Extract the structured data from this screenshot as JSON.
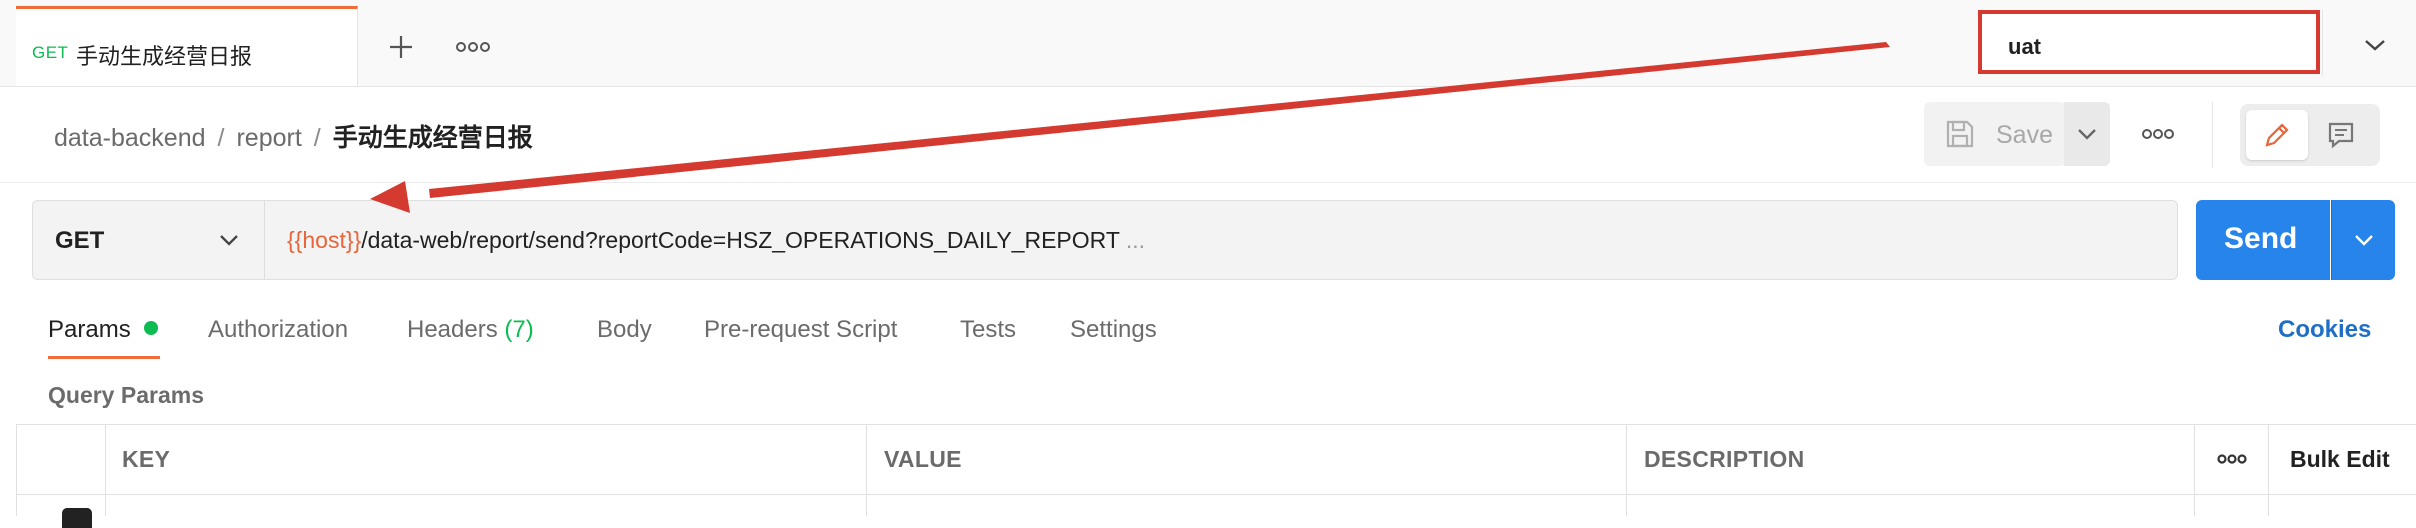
{
  "tab": {
    "method": "GET",
    "name": "手动生成经营日报"
  },
  "environment": {
    "selected": "uat"
  },
  "breadcrumb": {
    "items": [
      "data-backend",
      "report"
    ],
    "current": "手动生成经营日报"
  },
  "toolbar": {
    "save_label": "Save"
  },
  "request": {
    "method": "GET",
    "url_variable": "{{host}}",
    "url_path": "/data-web/report/send?reportCode=HSZ_OPERATIONS_DAILY_REPORT",
    "url_more": " ...",
    "send_label": "Send"
  },
  "subtabs": {
    "params": "Params",
    "authorization": "Authorization",
    "headers": "Headers",
    "headers_count": "(7)",
    "body": "Body",
    "prerequest": "Pre-request Script",
    "tests": "Tests",
    "settings": "Settings",
    "cookies": "Cookies"
  },
  "query_params": {
    "label": "Query Params",
    "columns": [
      "KEY",
      "VALUE",
      "DESCRIPTION"
    ],
    "bulk_edit": "Bulk Edit"
  },
  "colors": {
    "accent": "#f26b3a",
    "send": "#2684ea",
    "success": "#0cbb52",
    "annotation": "#d43a30"
  },
  "annotation": {
    "type": "arrow",
    "from": "environment-select",
    "to": "url-host-variable"
  }
}
